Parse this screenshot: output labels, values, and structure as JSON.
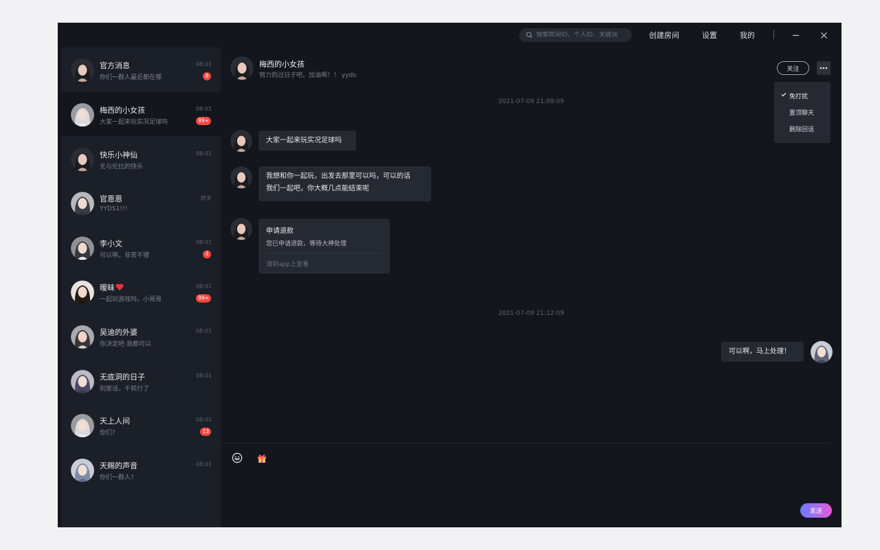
{
  "topbar": {
    "search_placeholder": "搜索房间ID、个人ID、关键词",
    "nav": [
      "创建房间",
      "设置",
      "我的"
    ]
  },
  "conversations": [
    {
      "name": "官方消息",
      "preview": "你们一群人最近都在哪",
      "time": "08:01",
      "badge": "8"
    },
    {
      "name": "梅西的小女孩",
      "preview": "大家一起来玩实况足球吗",
      "time": "08:01",
      "badge": "99+"
    },
    {
      "name": "快乐小神仙",
      "preview": "无与伦比的快乐",
      "time": "08:01",
      "badge": ""
    },
    {
      "name": "官恩恩",
      "preview": "YYDS1!!!",
      "time": "昨天",
      "badge": ""
    },
    {
      "name": "李小文",
      "preview": "可以啊，非常不错",
      "time": "08:01",
      "badge": "4"
    },
    {
      "name": "暧昧",
      "preview": "一起玩游戏吗，小哥哥",
      "time": "08:01",
      "badge": "99+",
      "emoji": "heart"
    },
    {
      "name": "吴迪的外婆",
      "preview": "你决定吧 我都可以",
      "time": "08:01",
      "badge": ""
    },
    {
      "name": "无底洞的日子",
      "preview": "别废话，干就行了",
      "time": "08:01",
      "badge": ""
    },
    {
      "name": "天上人间",
      "preview": "你们?",
      "time": "08:01",
      "badge": "13"
    },
    {
      "name": "天赐的声音",
      "preview": "你们一群人?",
      "time": "08:01",
      "badge": ""
    }
  ],
  "chat": {
    "title": "梅西的小女孩",
    "subtitle": "努力的过日子吧。加油啊！！ yyds",
    "follow_label": "关注",
    "menu": [
      "免打扰",
      "置顶聊天",
      "删除回话"
    ],
    "timestamps": [
      "2021-07-09  21:09:09",
      "2021-07-09  21:12:09"
    ],
    "messages": [
      {
        "text": "大家一起来玩实况足球吗"
      },
      {
        "lines": [
          "我想和你一起玩，出发去那里可以吗，可以的话",
          "我们一起吧，你大概几点能结束呢"
        ]
      },
      {
        "text": "可以啊，马上处理！"
      }
    ],
    "card": {
      "title": "申请退款",
      "body": "您已申请退款，等待大神处理",
      "link": "请到app上查看"
    },
    "send_label": "发送"
  },
  "colors": {
    "accent_gradient_start": "#6a7bff",
    "accent_gradient_end": "#e65bd6",
    "badge": "#f2473f"
  }
}
